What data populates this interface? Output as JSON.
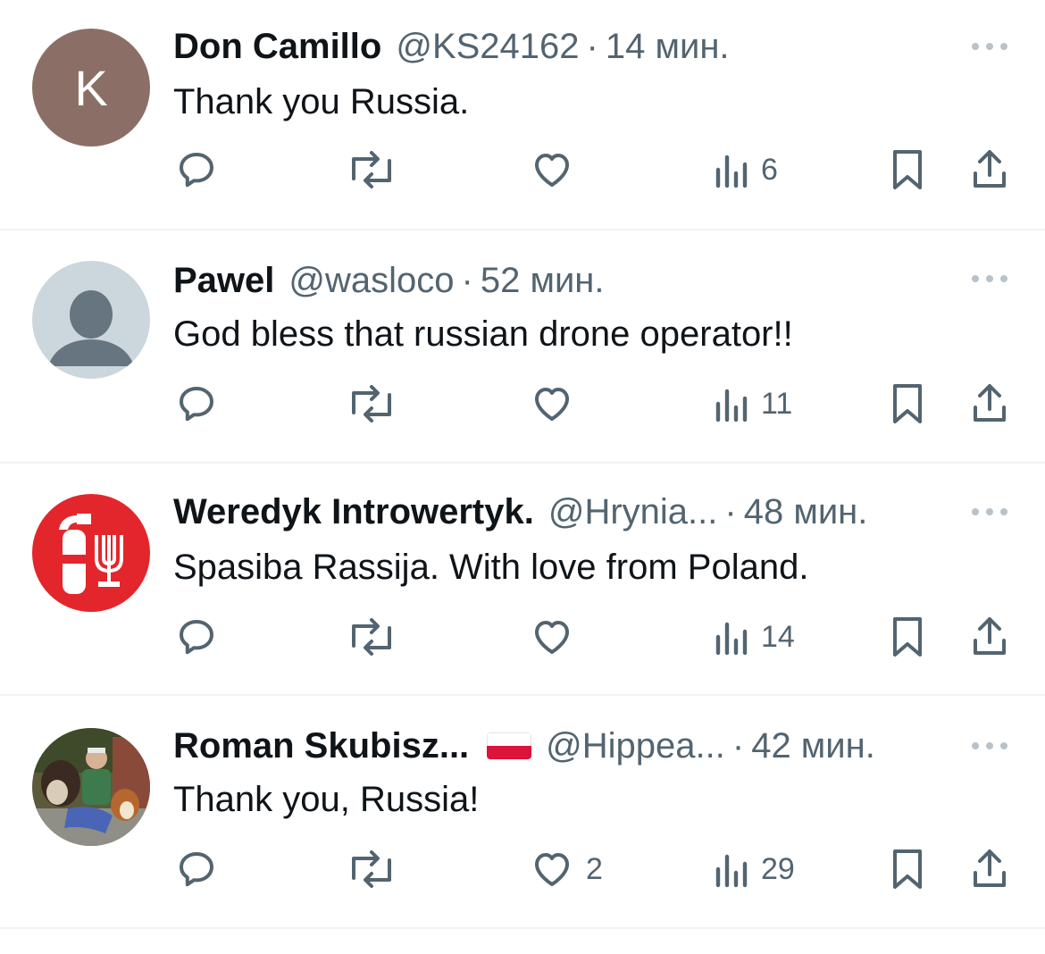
{
  "tweets": [
    {
      "name": "Don Camillo",
      "handle": "@KS24162",
      "separator": "·",
      "time": "14 мин.",
      "text": "Thank you Russia.",
      "avatar_letter": "K",
      "avatar_color": "#8b6f66",
      "likes": "",
      "views": "6",
      "flag": false
    },
    {
      "name": "Pawel",
      "handle": "@wasloco",
      "separator": "·",
      "time": "52 мин.",
      "text": "God bless that russian drone operator!!",
      "avatar_icon": "default-person-avatar",
      "likes": "",
      "views": "11",
      "flag": false
    },
    {
      "name": "Weredyk Introwertyk.",
      "handle": "@Hrynia...",
      "separator": "·",
      "time": "48 мин.",
      "text": "Spasiba Rassija. With love from Poland.",
      "avatar_icon": "fire-extinguisher-and-menorah-avatar",
      "likes": "",
      "views": "14",
      "flag": false
    },
    {
      "name": "Roman Skubisz...",
      "handle": "@Hippea...",
      "separator": "·",
      "time": "42 мин.",
      "text": "Thank you, Russia!",
      "avatar_icon": "photo-man-with-dogs-avatar",
      "likes": "2",
      "views": "29",
      "flag": true,
      "flag_icon": "poland-flag-icon"
    }
  ],
  "colors": {
    "primary_text": "#0f1419",
    "secondary_text": "#536471",
    "divider": "#eff3f4",
    "flag_red": "#dc143c"
  }
}
